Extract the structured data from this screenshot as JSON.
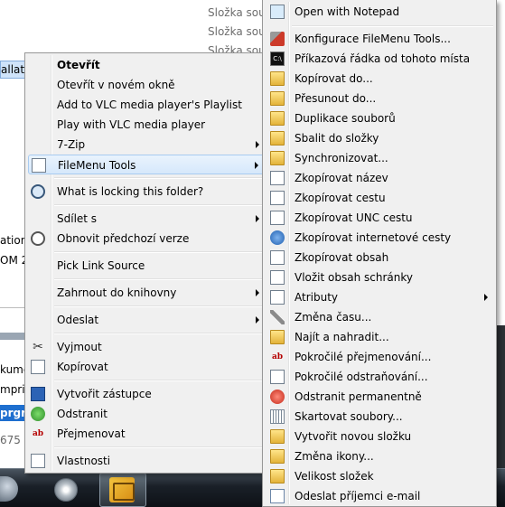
{
  "background": {
    "folder_rows": [
      "Složka soubo",
      "Složka soubo",
      "Složka soubo"
    ],
    "left_fragments": [
      "allation",
      "ation",
      "OM 2",
      "kume",
      "mpri",
      "prgra",
      "675"
    ]
  },
  "menu1": {
    "items": [
      {
        "label": "Otevřít",
        "icon": "",
        "bold": true
      },
      {
        "label": "Otevřít v novém okně",
        "icon": ""
      },
      {
        "label": "Add to VLC media player's Playlist",
        "icon": ""
      },
      {
        "label": "Play with VLC media player",
        "icon": ""
      },
      {
        "label": "7-Zip",
        "icon": "",
        "submenu": true
      },
      {
        "label": "FileMenu Tools",
        "icon": "filemenu-tools-icon",
        "submenu": true,
        "highlighted": true
      },
      {
        "label": "What is locking this folder?",
        "icon": "magnifier-icon"
      },
      {
        "label": "Sdílet s",
        "icon": "",
        "submenu": true
      },
      {
        "label": "Obnovit předchozí verze",
        "icon": "restore-clock-icon"
      },
      {
        "label": "Pick Link Source",
        "icon": ""
      },
      {
        "label": "Zahrnout do knihovny",
        "icon": "",
        "submenu": true
      },
      {
        "label": "Odeslat",
        "icon": "",
        "submenu": true
      },
      {
        "label": "Vyjmout",
        "icon": "scissors-icon"
      },
      {
        "label": "Kopírovat",
        "icon": "copy-icon"
      },
      {
        "label": "Vytvořit zástupce",
        "icon": "shortcut-icon"
      },
      {
        "label": "Odstranit",
        "icon": "delete-shield-icon"
      },
      {
        "label": "Přejmenovat",
        "icon": "rename-icon"
      },
      {
        "label": "Vlastnosti",
        "icon": "properties-icon"
      }
    ]
  },
  "menu2": {
    "items": [
      {
        "label": "Open with Notepad",
        "icon": "notepad-icon"
      },
      {
        "label": "Konfigurace FileMenu Tools...",
        "icon": "tools-config-icon"
      },
      {
        "label": "Příkazová řádka od tohoto místa",
        "icon": "command-prompt-icon"
      },
      {
        "label": "Kopírovat do...",
        "icon": "copy-to-icon"
      },
      {
        "label": "Přesunout do...",
        "icon": "move-to-icon"
      },
      {
        "label": "Duplikace souborů",
        "icon": "duplicate-icon"
      },
      {
        "label": "Sbalit do složky",
        "icon": "pack-folder-icon"
      },
      {
        "label": "Synchronizovat...",
        "icon": "sync-icon"
      },
      {
        "label": "Zkopírovat název",
        "icon": "copy-name-icon"
      },
      {
        "label": "Zkopírovat cestu",
        "icon": "copy-path-icon"
      },
      {
        "label": "Zkopírovat UNC cestu",
        "icon": "copy-unc-icon"
      },
      {
        "label": "Zkopírovat internetové cesty",
        "icon": "copy-internet-path-icon"
      },
      {
        "label": "Zkopírovat obsah",
        "icon": "copy-content-icon"
      },
      {
        "label": "Vložit obsah schránky",
        "icon": "paste-clipboard-icon"
      },
      {
        "label": "Atributy",
        "icon": "attributes-icon",
        "submenu": true
      },
      {
        "label": "Změna času...",
        "icon": "change-time-icon"
      },
      {
        "label": "Najít a nahradit...",
        "icon": "find-replace-icon"
      },
      {
        "label": "Pokročilé přejmenování...",
        "icon": "advanced-rename-icon"
      },
      {
        "label": "Pokročilé odstraňování...",
        "icon": "advanced-delete-icon"
      },
      {
        "label": "Odstranit permanentně",
        "icon": "delete-permanent-icon"
      },
      {
        "label": "Skartovat soubory...",
        "icon": "shred-icon"
      },
      {
        "label": "Vytvořit novou složku",
        "icon": "new-folder-icon"
      },
      {
        "label": "Změna ikony...",
        "icon": "change-icon-icon"
      },
      {
        "label": "Velikost složek",
        "icon": "folder-size-icon"
      },
      {
        "label": "Odeslat příjemci e-mail",
        "icon": "mail-recipient-icon"
      }
    ]
  },
  "colors": {
    "menu_bg": "#f0f0f0",
    "highlight": "#d6e8fb",
    "taskbar": "#1a2028"
  }
}
